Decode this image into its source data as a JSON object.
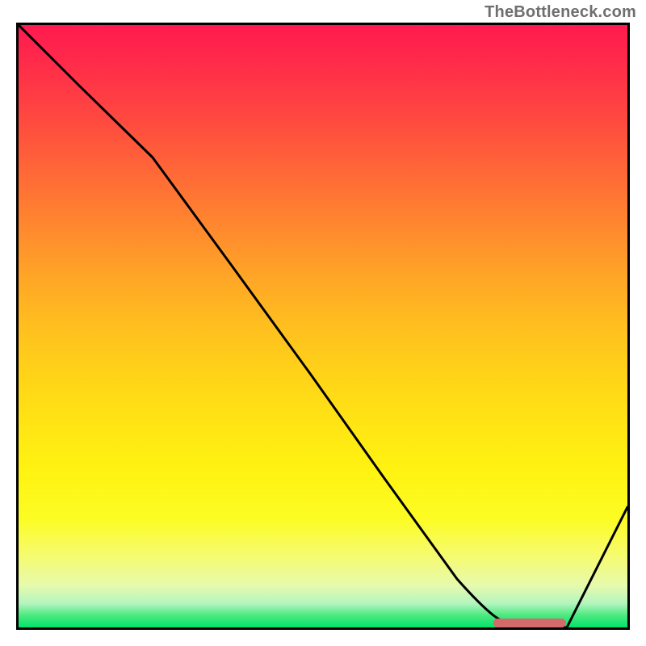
{
  "watermark": {
    "text": "TheBottleneck.com"
  },
  "chart_data": {
    "type": "line",
    "title": "",
    "xlabel": "",
    "ylabel": "",
    "xlim": [
      0,
      100
    ],
    "ylim": [
      0,
      100
    ],
    "grid": false,
    "legend": null,
    "series": [
      {
        "name": "bottleneck-curve",
        "x": [
          0,
          10,
          22,
          35,
          48,
          60,
          72,
          78,
          83,
          90,
          100
        ],
        "y": [
          100,
          90,
          78,
          60,
          42,
          25,
          8,
          2,
          0,
          0,
          20
        ]
      }
    ],
    "minimum_marker": {
      "x_start": 78,
      "x_end": 90,
      "y": 0
    },
    "background": "rainbow-gradient-red-to-green-vertical"
  }
}
